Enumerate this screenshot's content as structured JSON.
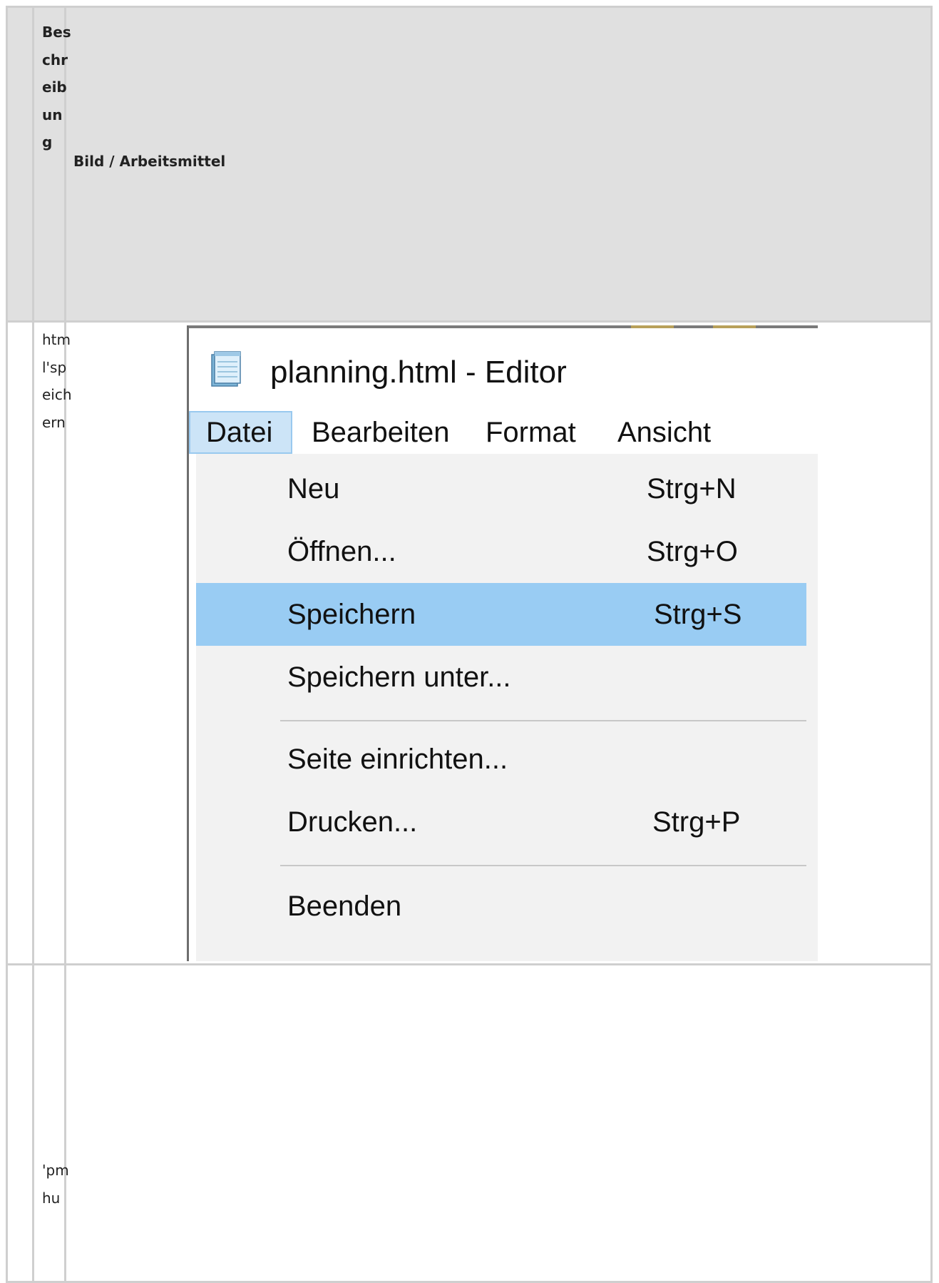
{
  "table": {
    "header": {
      "col2": "Beschreibung",
      "col3": "Bild / Arbeitsmittel"
    },
    "rows": [
      {
        "col2": "html'speichern"
      },
      {
        "col2": "'pmhu"
      }
    ]
  },
  "screenshot": {
    "window_title": "planning.html - Editor",
    "icon": "notepad-icon",
    "menu": [
      "Datei",
      "Bearbeiten",
      "Format",
      "Ansicht"
    ],
    "active_menu": "Datei",
    "dropdown": [
      {
        "label": "Neu",
        "shortcut": "Strg+N"
      },
      {
        "label": "Öffnen...",
        "shortcut": "Strg+O"
      },
      {
        "label": "Speichern",
        "shortcut": "Strg+S"
      },
      {
        "label": "Speichern unter...",
        "shortcut": ""
      },
      {
        "label": "Seite einrichten...",
        "shortcut": ""
      },
      {
        "label": "Drucken...",
        "shortcut": "Strg+P"
      },
      {
        "label": "Beenden",
        "shortcut": ""
      }
    ],
    "highlighted_item": "Speichern",
    "colors": {
      "highlight": "#99ccf3",
      "active_menu_bg": "#cce4f7",
      "menu_bg": "#f2f2f2"
    }
  }
}
